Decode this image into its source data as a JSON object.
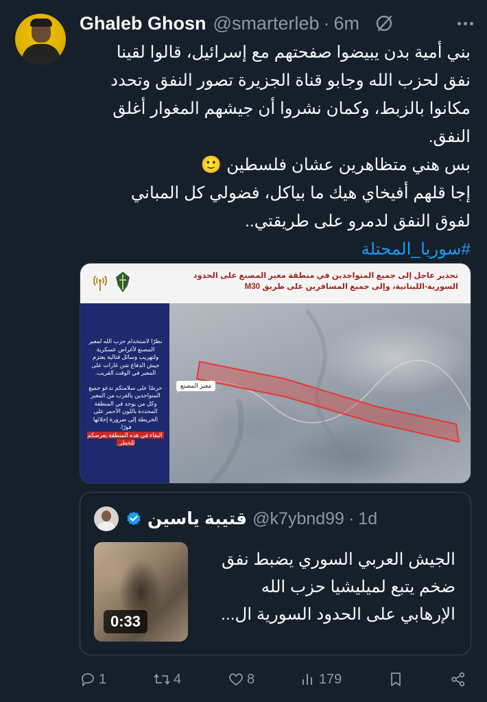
{
  "tweet": {
    "author_name": "Ghaleb Ghosn",
    "author_handle": "@smarterleb",
    "separator": "·",
    "time": "6m",
    "text_lines": [
      "بني أمية بدن يبيضوا صفحتهم مع إسرائيل، قالوا لقينا",
      "نفق لحزب الله وجابو قناة الجزيرة تصور النفق وتحدد",
      "مكانوا بالزبط، وكمان نشروا أن جيشهم المغوار أغلق",
      "النفق.",
      "بس هني متظاهرين عشان فلسطين 🙂",
      "إجا قلهم أفيخاي هيك ما بياكل، فضولي كل المباني",
      "لفوق النفق لدمرو على طريقتي.."
    ],
    "hashtag": "#سوريا_المحتلة"
  },
  "media": {
    "title": "تحذير عاجل إلى جميع المتواجدين في منطقة معبر المصنع على الحدود السورية-اللبنانية، وإلى جميع المسافرين على طريق M30",
    "side_text_main": "نظرًا لاستخدام حزب الله لمعبر المصنع لأغراض عسكرية ولتهريب وسائل قتالية يعتزم جيش الدفاع شن غارات على المعبر في الوقت القريب.",
    "side_text_second": "حرصًا على سلامتكم ندعو جميع المتواجدين بالقرب من المعبر وكل من يوجد في المنطقة المحددة باللون الأحمر على الخريطة إلى ضرورة إخلائها فورًا.",
    "side_text_warning": "البقاء في هذه المنطقة يعرضكم للخطر.",
    "map_label": "معبر المصنع"
  },
  "quote": {
    "author_name": "قتيبة ياسين",
    "author_handle": "@k7ybnd99",
    "separator": "·",
    "time": "1d",
    "video_duration": "0:33",
    "text_lines": [
      "الجيش العربي السوري يضبط نفق",
      "ضخم يتبع لميليشيا حزب الله",
      "الإرهابي على الحدود السورية ال..."
    ]
  },
  "actions": {
    "replies": "1",
    "reposts": "4",
    "likes": "8",
    "views": "179"
  },
  "icons": {
    "grok": "slashed-circle-icon",
    "more": "more-icon",
    "reply": "reply-icon",
    "repost": "repost-icon",
    "like": "heart-icon",
    "views": "views-icon",
    "bookmark": "bookmark-icon",
    "share": "share-icon",
    "verified": "verified-badge-icon"
  },
  "colors": {
    "background": "#15202b",
    "text": "#f7f9f9",
    "secondary": "#8b98a5",
    "accent": "#1d9bf0",
    "warning_red": "#c62828"
  }
}
